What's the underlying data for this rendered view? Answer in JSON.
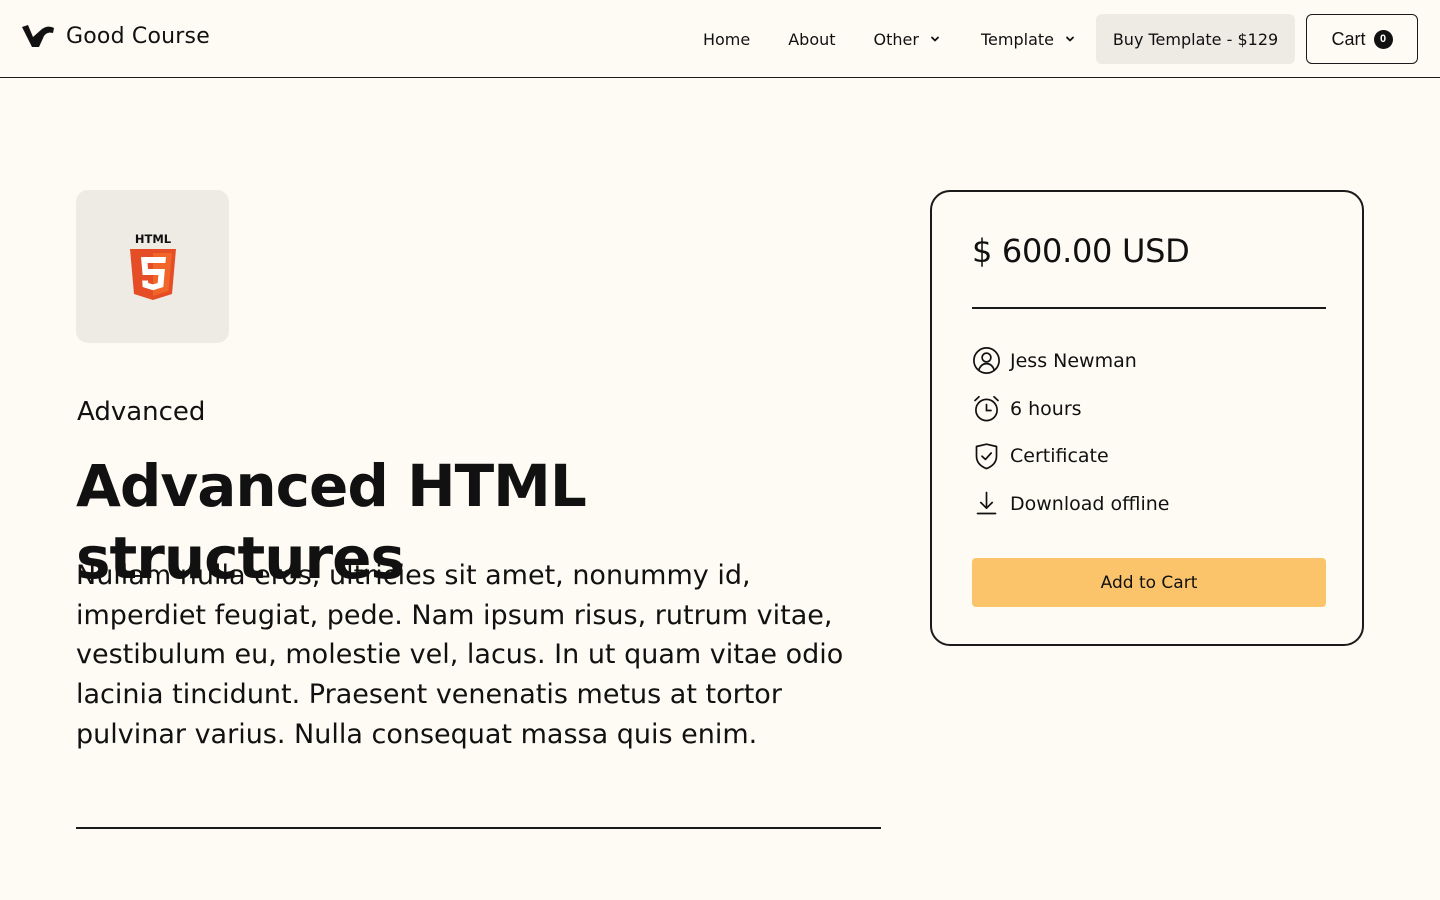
{
  "header": {
    "brand_name": "Good Course",
    "nav": {
      "home": "Home",
      "about": "About",
      "other": "Other",
      "template": "Template",
      "buy_template": "Buy Template - $129",
      "cart_label": "Cart",
      "cart_count": "0"
    }
  },
  "course": {
    "icon_text": "HTML",
    "icon_digit": "5",
    "level": "Advanced",
    "title": "Advanced HTML structures",
    "description": "Nullam nulla eros, ultricies sit amet, nonummy id, imperdiet feugiat, pede. Nam ipsum risus, rutrum vitae, vestibulum eu, molestie vel, lacus. In ut quam vitae odio lacinia tincidunt. Praesent venenatis metus at tortor pulvinar varius. Nulla consequat massa quis enim."
  },
  "card": {
    "price": "$ 600.00 USD",
    "features": [
      {
        "icon": "user-circle-icon",
        "label": "Jess Newman"
      },
      {
        "icon": "alarm-clock-icon",
        "label": "6 hours"
      },
      {
        "icon": "shield-check-icon",
        "label": "Certificate"
      },
      {
        "icon": "download-icon",
        "label": "Download offline"
      }
    ],
    "add_to_cart": "Add to Cart"
  },
  "colors": {
    "background": "#fdfbf4",
    "accent_button": "#fbc46a",
    "muted_box": "#eeebe5",
    "html5_orange": "#e44d26"
  }
}
